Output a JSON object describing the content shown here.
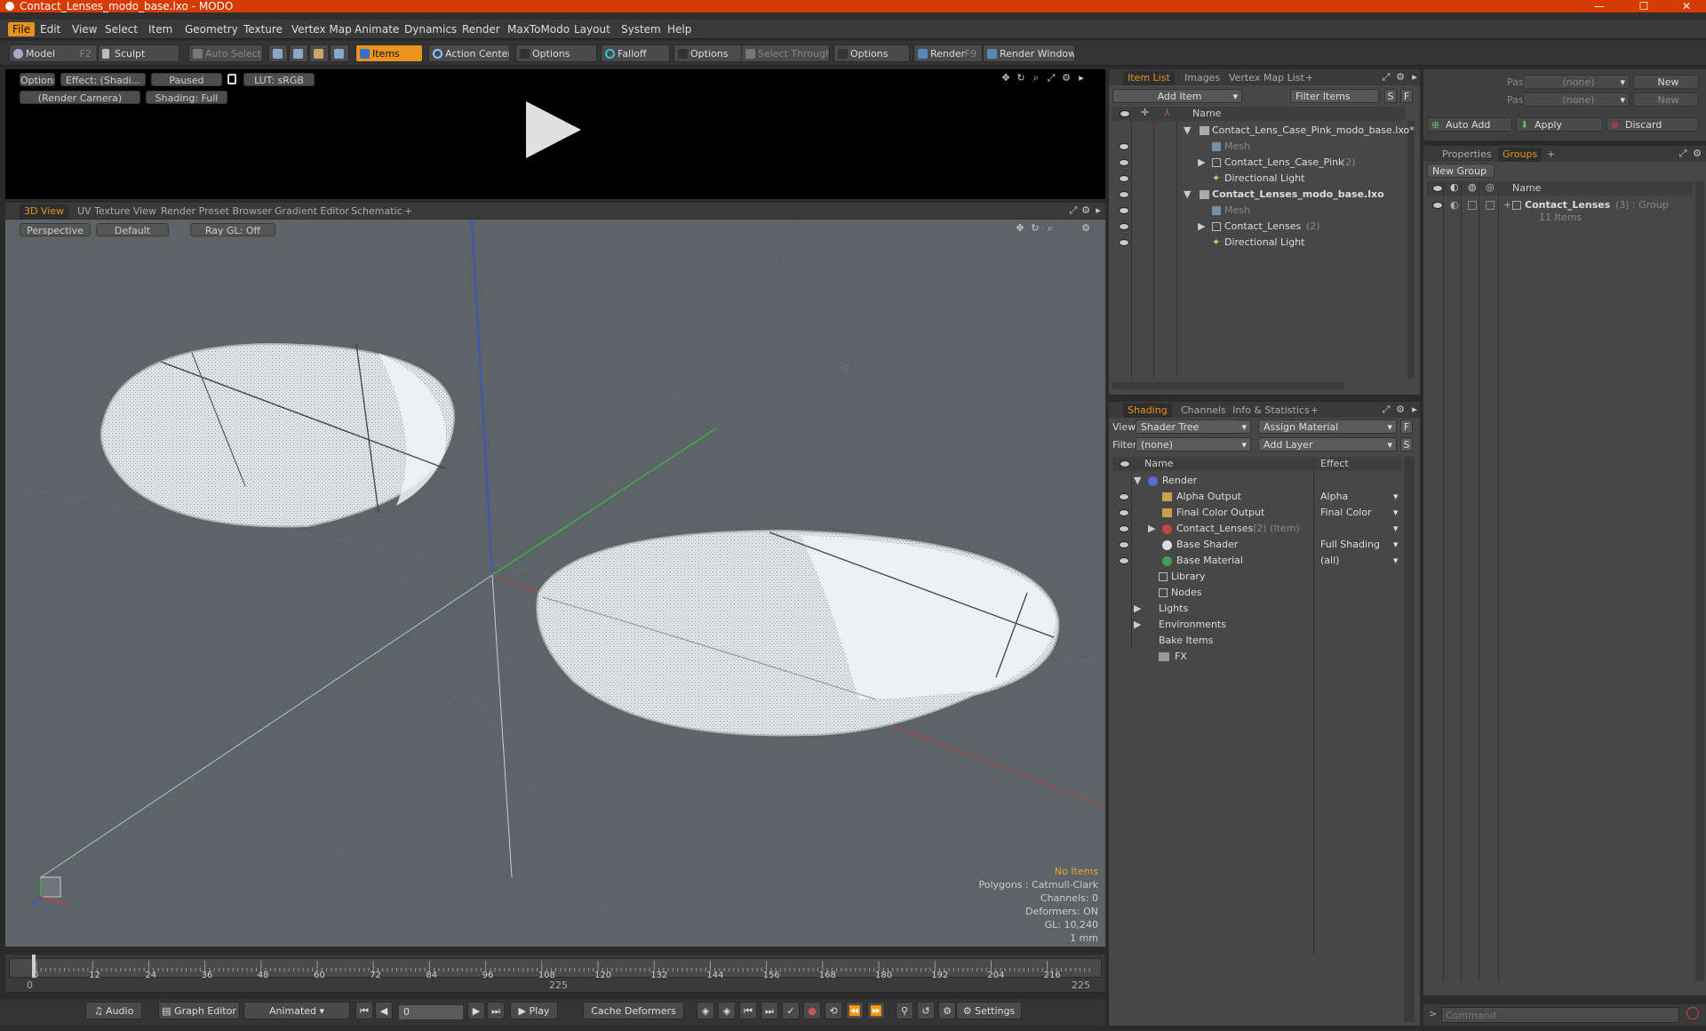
{
  "window": {
    "title": "Contact_Lenses_modo_base.lxo - MODO",
    "minimize": "—",
    "maximize": "☐",
    "close": "✕"
  },
  "menu": [
    "File",
    "Edit",
    "View",
    "Select",
    "Item",
    "Geometry",
    "Texture",
    "Vertex Map",
    "Animate",
    "Dynamics",
    "Render",
    "MaxToModo",
    "Layout",
    "System",
    "Help"
  ],
  "toolbar": {
    "model": "Model",
    "model_key": "F2",
    "sculpt": "Sculpt",
    "auto_select": "Auto Select",
    "items": "Items",
    "action_center": "Action Center",
    "options1": "Options",
    "falloff": "Falloff",
    "options2": "Options",
    "select_through": "Select Through",
    "options3": "Options",
    "render": "Render",
    "render_key": "F9",
    "render_window": "Render Window"
  },
  "preview": {
    "options": "Options",
    "effect": "Effect: (Shadi...",
    "paused": "Paused",
    "lut": "LUT: sRGB",
    "camera": "(Render Camera)",
    "shading": "Shading: Full"
  },
  "viewport_tabs": [
    "3D View",
    "UV Texture View",
    "Render Preset Browser",
    "Gradient Editor",
    "Schematic",
    "+"
  ],
  "viewport": {
    "perspective": "Perspective",
    "default": "Default",
    "raygl": "Ray GL: Off",
    "axis_label": "-Z",
    "info": {
      "no_items": "No Items",
      "polygons": "Polygons : Catmull-Clark",
      "channels": "Channels: 0",
      "deformers": "Deformers: ON",
      "gl": "GL: 10,240",
      "unit": "1 mm"
    },
    "colors": {
      "bg": "#5d6468",
      "lens": "#e6ebec",
      "x_axis": "#c94040",
      "y_axis": "#3fae4a",
      "z_axis": "#3a4fd0"
    }
  },
  "timeline": {
    "ticks": [
      "0",
      "12",
      "24",
      "36",
      "48",
      "60",
      "72",
      "84",
      "96",
      "108",
      "120",
      "132",
      "144",
      "156",
      "168",
      "180",
      "192",
      "204",
      "216"
    ],
    "range": {
      "start": "0",
      "mid": "225",
      "end": "225"
    }
  },
  "bottombar": {
    "audio": "Audio",
    "graph_editor": "Graph Editor",
    "animated": "Animated",
    "frame": "0",
    "play": "Play",
    "cache_deformers": "Cache Deformers",
    "settings": "Settings"
  },
  "itemlist": {
    "tabs": [
      "Item List",
      "Images",
      "Vertex Map List",
      "+"
    ],
    "add_item": "Add Item",
    "filter_items": "Filter Items",
    "s_btn": "S",
    "f_btn": "F",
    "col_name": "Name",
    "rows": [
      {
        "label": "Contact_Lens_Case_Pink_modo_base.lxo*",
        "count": "",
        "style": "scene"
      },
      {
        "label": "Mesh",
        "count": "",
        "style": "dim"
      },
      {
        "label": "Contact_Lens_Case_Pink",
        "count": "(2)",
        "style": "group"
      },
      {
        "label": "Directional Light",
        "count": "",
        "style": "light"
      },
      {
        "label": "Contact_Lenses_modo_base.lxo",
        "count": "",
        "style": "scene-bold"
      },
      {
        "label": "Mesh",
        "count": "",
        "style": "dim"
      },
      {
        "label": "Contact_Lenses",
        "count": "(2)",
        "style": "group"
      },
      {
        "label": "Directional Light",
        "count": "",
        "style": "light"
      }
    ]
  },
  "shading": {
    "tabs": [
      "Shading",
      "Channels",
      "Info & Statistics",
      "+"
    ],
    "view_label": "View",
    "view_value": "Shader Tree",
    "assign_material": "Assign Material",
    "f_btn": "F",
    "filter_label": "Filter",
    "filter_value": "(none)",
    "add_layer": "Add Layer",
    "s_btn": "S",
    "col_name": "Name",
    "col_effect": "Effect",
    "rows": [
      {
        "label": "Render",
        "effect": "",
        "extra": ""
      },
      {
        "label": "Alpha Output",
        "effect": "Alpha",
        "extra": ""
      },
      {
        "label": "Final Color Output",
        "effect": "Final Color",
        "extra": ""
      },
      {
        "label": "Contact_Lenses",
        "effect": "",
        "extra": "(2) (Item)"
      },
      {
        "label": "Base Shader",
        "effect": "Full Shading",
        "extra": ""
      },
      {
        "label": "Base Material",
        "effect": "(all)",
        "extra": ""
      },
      {
        "label": "Library",
        "effect": "",
        "extra": ""
      },
      {
        "label": "Nodes",
        "effect": "",
        "extra": ""
      },
      {
        "label": "Lights",
        "effect": "",
        "extra": ""
      },
      {
        "label": "Environments",
        "effect": "",
        "extra": ""
      },
      {
        "label": "Bake Items",
        "effect": "",
        "extra": ""
      },
      {
        "label": "FX",
        "effect": "",
        "extra": ""
      }
    ]
  },
  "groups": {
    "pass_groups_label": "Pass Groups",
    "pass_groups_value": "(none)",
    "new1": "New",
    "passes_label": "Passes",
    "passes_value": "(none)",
    "new2": "New",
    "auto_add": "Auto Add",
    "apply": "Apply",
    "discard": "Discard",
    "tabs": [
      "Properties",
      "Groups",
      "+"
    ],
    "new_group": "New Group",
    "col_name": "Name",
    "group_name": "Contact_Lenses",
    "group_meta": "(3) : Group",
    "group_items": "11 Items",
    "command_placeholder": "Command"
  }
}
